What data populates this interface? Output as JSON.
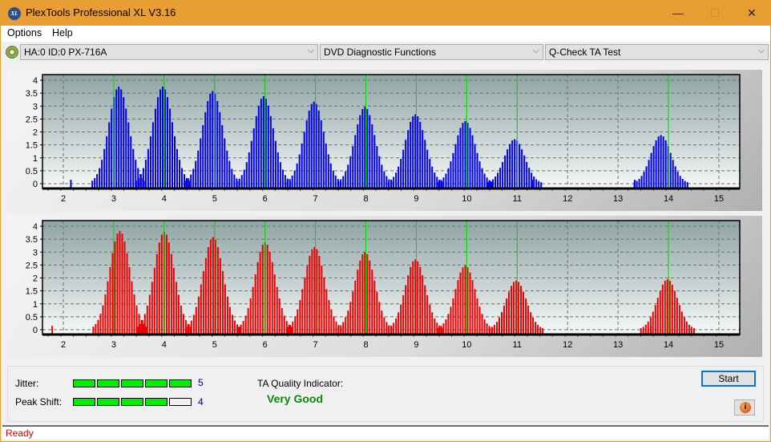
{
  "window": {
    "title": "PlexTools Professional XL V3.16",
    "icon_label": "XL",
    "minimize_glyph": "—",
    "maximize_glyph": "☐",
    "close_glyph": "✕"
  },
  "menu": {
    "items": [
      {
        "label": "Options"
      },
      {
        "label": "Help"
      }
    ]
  },
  "toolbar": {
    "drive": "HA:0 ID:0  PX-716A",
    "function_group": "DVD Diagnostic Functions",
    "test": "Q-Check TA Test",
    "chevron": "⌵"
  },
  "colors": {
    "titlebar": "#e89e33",
    "top_bars": "#0000ee",
    "bottom_bars": "#ee0000",
    "marker_lines": "#00dd00",
    "meter_on": "#00ee00",
    "quality_text": "#0a8a0a",
    "status_text": "#e00000"
  },
  "chart_data": [
    {
      "type": "bar",
      "name": "land-ta-histogram",
      "series_color": "#0000ee",
      "xlim": [
        1.6,
        15.4
      ],
      "ylim": [
        0,
        4
      ],
      "x_ticks": [
        2,
        3,
        4,
        5,
        6,
        7,
        8,
        9,
        10,
        11,
        12,
        13,
        14,
        15
      ],
      "y_ticks": [
        0,
        0.5,
        1,
        1.5,
        2,
        2.5,
        3,
        3.5,
        4
      ],
      "y_tick_labels": [
        "0",
        "0.5",
        "1",
        "1.5",
        "2",
        "2.5",
        "3",
        "3.5",
        "4"
      ],
      "grid": true,
      "reference_lines_x": [
        3,
        4,
        5,
        6,
        7,
        8,
        9,
        10,
        11,
        14
      ],
      "peaks": [
        {
          "center": 3.1,
          "height": 3.75
        },
        {
          "center": 3.97,
          "height": 3.75
        },
        {
          "center": 4.96,
          "height": 3.58
        },
        {
          "center": 5.97,
          "height": 3.38
        },
        {
          "center": 6.97,
          "height": 3.17
        },
        {
          "center": 7.98,
          "height": 2.97
        },
        {
          "center": 8.98,
          "height": 2.68
        },
        {
          "center": 9.97,
          "height": 2.42
        },
        {
          "center": 10.95,
          "height": 1.72
        },
        {
          "center": 13.85,
          "height": 1.88
        }
      ],
      "outliers": [
        {
          "x": 2.15,
          "y": 0.02
        },
        {
          "x": 11.3,
          "y": 0.02
        },
        {
          "x": 13.33,
          "y": 0.02
        }
      ]
    },
    {
      "type": "bar",
      "name": "groove-ta-histogram",
      "series_color": "#ee0000",
      "xlim": [
        1.6,
        15.4
      ],
      "ylim": [
        0,
        4
      ],
      "x_ticks": [
        2,
        3,
        4,
        5,
        6,
        7,
        8,
        9,
        10,
        11,
        12,
        13,
        14,
        15
      ],
      "y_ticks": [
        0,
        0.5,
        1,
        1.5,
        2,
        2.5,
        3,
        3.5,
        4
      ],
      "y_tick_labels": [
        "0",
        "0.5",
        "1",
        "1.5",
        "2",
        "2.5",
        "3",
        "3.5",
        "4"
      ],
      "grid": true,
      "reference_lines_x": [
        3,
        4,
        5,
        6,
        7,
        8,
        9,
        10,
        11,
        14
      ],
      "peaks": [
        {
          "center": 3.12,
          "height": 3.82
        },
        {
          "center": 4.0,
          "height": 3.78
        },
        {
          "center": 4.97,
          "height": 3.58
        },
        {
          "center": 6.0,
          "height": 3.38
        },
        {
          "center": 6.98,
          "height": 3.2
        },
        {
          "center": 7.98,
          "height": 3.0
        },
        {
          "center": 8.98,
          "height": 2.72
        },
        {
          "center": 9.97,
          "height": 2.48
        },
        {
          "center": 10.98,
          "height": 1.9
        },
        {
          "center": 13.98,
          "height": 1.95
        }
      ],
      "outliers": [
        {
          "x": 1.78,
          "y": 0.02
        },
        {
          "x": 13.65,
          "y": 0.02
        }
      ]
    }
  ],
  "metrics": {
    "jitter": {
      "label": "Jitter:",
      "value": "5",
      "level": 5,
      "max": 5
    },
    "peak_shift": {
      "label": "Peak Shift:",
      "value": "4",
      "level": 4,
      "max": 5
    }
  },
  "quality": {
    "label": "TA Quality Indicator:",
    "value": "Very Good"
  },
  "buttons": {
    "start": "Start",
    "info_glyph": "i"
  },
  "status": {
    "text": "Ready"
  }
}
